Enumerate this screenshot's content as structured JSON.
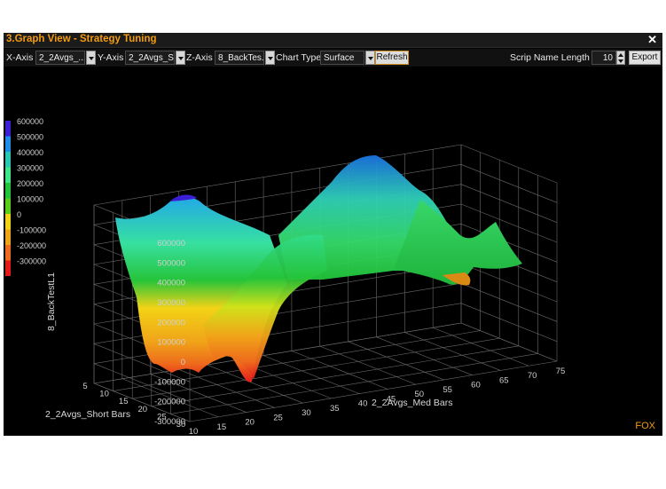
{
  "window": {
    "title": "3.Graph View - Strategy Tuning",
    "close_icon": "close-icon"
  },
  "toolbar": {
    "x_axis_label": "X-Axis",
    "x_axis_value": "2_2Avgs_...",
    "y_axis_label": "Y-Axis",
    "y_axis_value": "2_2Avgs_S...",
    "z_axis_label": "Z-Axis",
    "z_axis_value": "8_BackTes...",
    "chart_type_label": "Chart Type",
    "chart_type_value": "Surface",
    "refresh_label": "Refresh",
    "scrip_label": "Scrip Name Length :",
    "scrip_value": "10",
    "export_label": "Export"
  },
  "brand": "FOX",
  "colors": {
    "title_accent": "#f39c12",
    "background": "#000000",
    "grid": "#6a6a6a",
    "axis_text": "#cfcfcf"
  },
  "chart_data": {
    "type": "surface",
    "xlabel": "2_2Avgs_Med Bars",
    "ylabel": "2_2Avgs_Short Bars",
    "zlabel": "8_BackTestL1",
    "x_ticks": [
      "10",
      "15",
      "20",
      "25",
      "30",
      "35",
      "40",
      "45",
      "50",
      "55",
      "60",
      "65",
      "70",
      "75"
    ],
    "y_ticks": [
      "5",
      "10",
      "15",
      "20",
      "25",
      "30"
    ],
    "z_ticks": [
      "-300000",
      "-200000",
      "-100000",
      "0",
      "100000",
      "200000",
      "300000",
      "400000",
      "500000",
      "600000"
    ],
    "xlim": [
      10,
      75
    ],
    "ylim": [
      5,
      30
    ],
    "zlim": [
      -300000,
      600000
    ],
    "legend": {
      "position": "left",
      "levels": [
        {
          "label": "600000",
          "color": "#3a1fd6"
        },
        {
          "label": "500000",
          "color": "#1f8ee8"
        },
        {
          "label": "400000",
          "color": "#29c9b4"
        },
        {
          "label": "300000",
          "color": "#3ee88a"
        },
        {
          "label": "200000",
          "color": "#22c43a"
        },
        {
          "label": "100000",
          "color": "#58d019"
        },
        {
          "label": "0",
          "color": "#f2d316"
        },
        {
          "label": "-100000",
          "color": "#f0a418"
        },
        {
          "label": "-200000",
          "color": "#ee6a1c"
        },
        {
          "label": "-300000",
          "color": "#e31a1a"
        }
      ]
    },
    "surface_profile": {
      "x": [
        10,
        15,
        20,
        25,
        30,
        35,
        40,
        45,
        50,
        55,
        60,
        65,
        70,
        75
      ],
      "z_back_y30": [
        500000,
        460000,
        560000,
        200000,
        250000,
        300000,
        520000,
        460000,
        300000,
        260000,
        320000,
        230000,
        280000,
        200000
      ],
      "z_front_y5": [
        100000,
        -150000,
        -100000,
        -280000,
        50000,
        150000,
        250000,
        230000,
        150000,
        60000,
        120000,
        0,
        100000,
        150000
      ]
    }
  }
}
